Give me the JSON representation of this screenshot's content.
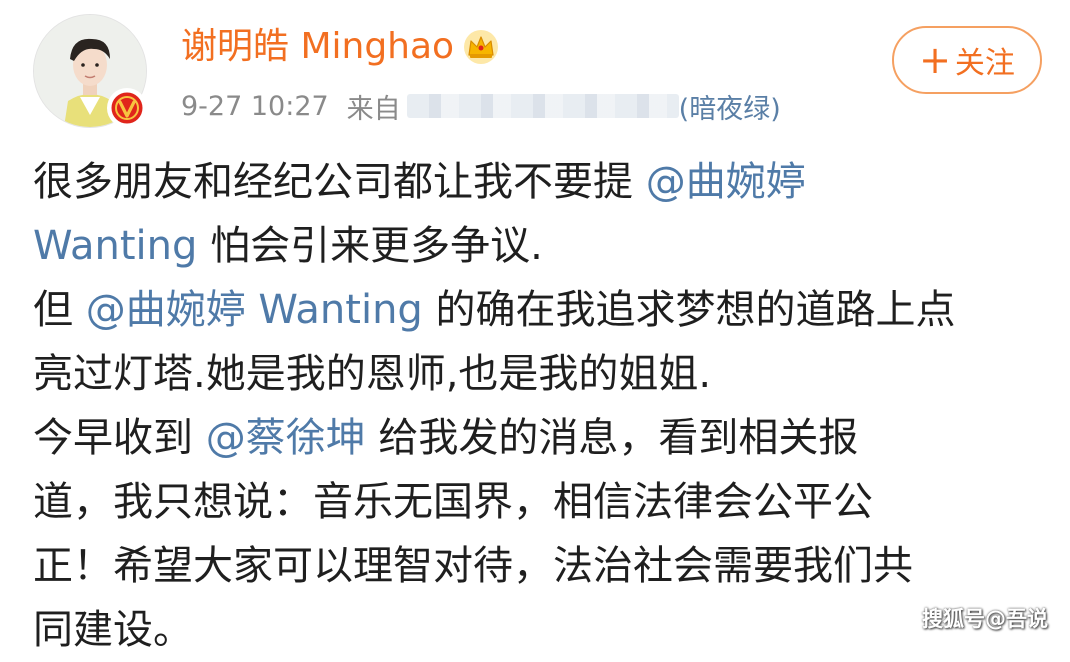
{
  "post": {
    "author": {
      "name": "谢明皓 Minghao",
      "avatar_icon": "avatar-photo",
      "verified_icon": "verified-v-badge",
      "vip_icon": "crown-icon"
    },
    "meta": {
      "time": "9-27 10:27",
      "source_prefix": "来自",
      "device": "(暗夜绿)"
    },
    "follow_label": "关注",
    "follow_symbol": "+",
    "content": {
      "line1": {
        "text": "很多朋友和经纪公司都让我不要提 ",
        "mention": "@曲婉婷"
      },
      "line2": {
        "mention": "Wanting",
        "text": " 怕会引来更多争议."
      },
      "line3": {
        "text_before": "但 ",
        "mention": "@曲婉婷 Wanting",
        "text_after": " 的确在我追求梦想的道路上点"
      },
      "line4": {
        "text": "亮过灯塔.她是我的恩师,也是我的姐姐."
      },
      "line5": {
        "text_before": "今早收到 ",
        "mention": "@蔡徐坤",
        "text_after": " 给我发的消息，看到相关报"
      },
      "line6": {
        "text": "道，我只想说：音乐无国界，相信法律会公平公"
      },
      "line7": {
        "text": "正！希望大家可以理智对待，法治社会需要我们共"
      },
      "line8": {
        "text": "同建设。"
      }
    }
  },
  "watermark": "搜狐号@吾说",
  "colors": {
    "username": "#f26f21",
    "mention": "#4f7aa8",
    "meta": "#8a8a8a",
    "verified_badge": "#e0251b",
    "crown": "#f7b500"
  }
}
